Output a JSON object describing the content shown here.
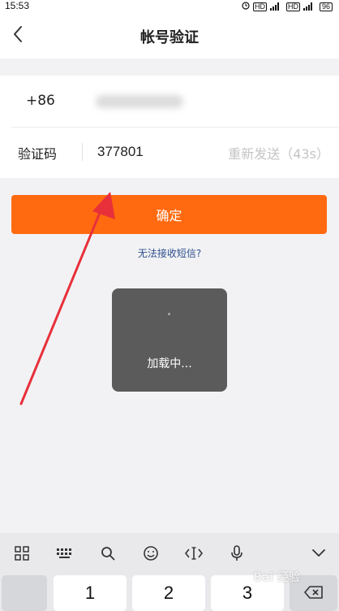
{
  "status_bar": {
    "time": "15:53",
    "battery": "96"
  },
  "nav": {
    "title": "帐号验证"
  },
  "form": {
    "country_code": "+86",
    "code_label": "验证码",
    "code_value": "377801",
    "resend_label": "重新发送（43s）"
  },
  "actions": {
    "confirm_label": "确定",
    "cant_receive_label": "无法接收短信?"
  },
  "loading": {
    "text": "加载中..."
  },
  "keyboard": {
    "toolbar_icons": [
      "grid-icon",
      "keyboard-icon",
      "search-icon",
      "emoji-icon",
      "cursor-icon",
      "microphone-icon",
      "collapse-icon"
    ],
    "keys": [
      "1",
      "2",
      "3"
    ]
  },
  "watermark": {
    "text": "Bai 经验"
  },
  "colors": {
    "accent": "#ff6a10",
    "link": "#2d4f8e",
    "annotation_arrow": "#e8303a"
  }
}
